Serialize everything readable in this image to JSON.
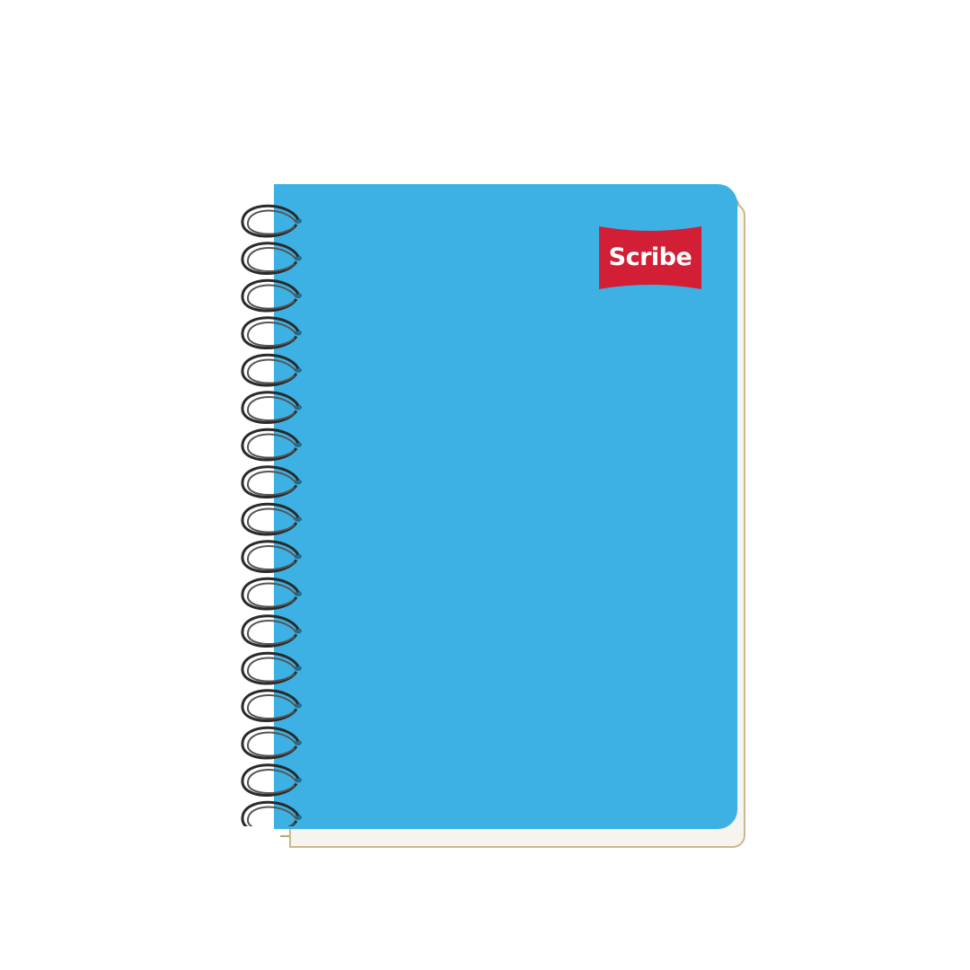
{
  "notebook": {
    "brand_text": "Scribe",
    "cover_color": "#3eb1e4",
    "logo_color": "#d21f35",
    "spiral_color": "#2a2a2a",
    "ring_count": 17
  }
}
